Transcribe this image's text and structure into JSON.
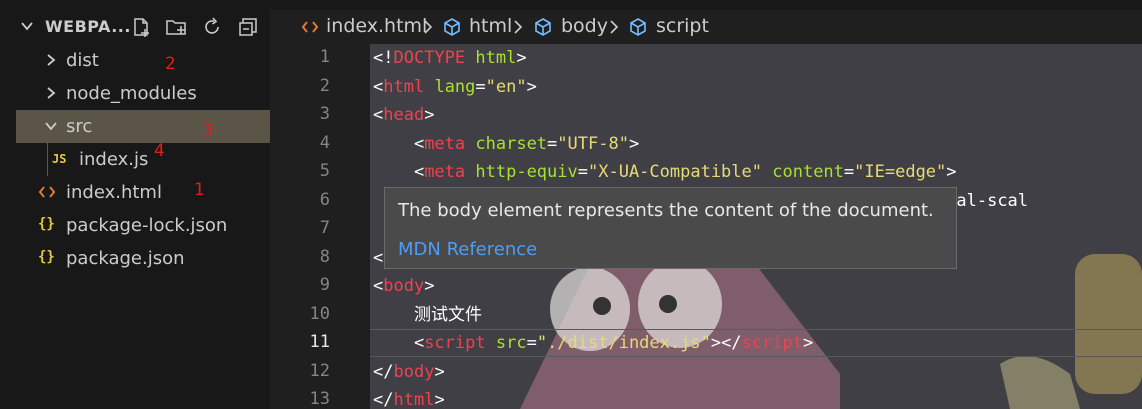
{
  "sidebar": {
    "title": "WEBPA...",
    "actions": [
      "new-file-icon",
      "new-folder-icon",
      "refresh-icon",
      "collapse-all-icon"
    ],
    "items": [
      {
        "label": "dist",
        "kind": "folder",
        "expanded": false,
        "annotation": "2"
      },
      {
        "label": "node_modules",
        "kind": "folder",
        "expanded": false,
        "annotation": ""
      },
      {
        "label": "src",
        "kind": "folder",
        "expanded": true,
        "selected": true,
        "annotation": "3"
      },
      {
        "label": "index.js",
        "kind": "js",
        "icon_text": "JS",
        "annotation": "4"
      },
      {
        "label": "index.html",
        "kind": "html",
        "annotation": "1"
      },
      {
        "label": "package-lock.json",
        "kind": "json",
        "icon_text": "{}",
        "annotation": ""
      },
      {
        "label": "package.json",
        "kind": "json",
        "icon_text": "{}",
        "annotation": ""
      }
    ]
  },
  "breadcrumb": [
    "index.html",
    "html",
    "body",
    "script"
  ],
  "editor": {
    "line_numbers": [
      "1",
      "2",
      "3",
      "4",
      "5",
      "6",
      "7",
      "8",
      "9",
      "10",
      "11",
      "12",
      "13"
    ],
    "active_line": "11",
    "lines": [
      [
        [
          "br",
          "<!"
        ],
        [
          "tag",
          "DOCTYPE"
        ],
        [
          "br",
          " "
        ],
        [
          "attr",
          "html"
        ],
        [
          "br",
          ">"
        ]
      ],
      [
        [
          "br",
          "<"
        ],
        [
          "tag",
          "html"
        ],
        [
          "br",
          " "
        ],
        [
          "attr",
          "lang"
        ],
        [
          "br",
          "="
        ],
        [
          "str",
          "\"en\""
        ],
        [
          "br",
          ">"
        ]
      ],
      [
        [
          "br",
          "<"
        ],
        [
          "tag",
          "head"
        ],
        [
          "br",
          ">"
        ]
      ],
      [
        [
          "br",
          "    <"
        ],
        [
          "tag",
          "meta"
        ],
        [
          "br",
          " "
        ],
        [
          "attr",
          "charset"
        ],
        [
          "br",
          "="
        ],
        [
          "str",
          "\"UTF-8\""
        ],
        [
          "br",
          ">"
        ]
      ],
      [
        [
          "br",
          "    <"
        ],
        [
          "tag",
          "meta"
        ],
        [
          "br",
          " "
        ],
        [
          "attr",
          "http-equiv"
        ],
        [
          "br",
          "="
        ],
        [
          "str",
          "\"X-UA-Compatible\""
        ],
        [
          "br",
          " "
        ],
        [
          "attr",
          "content"
        ],
        [
          "br",
          "="
        ],
        [
          "str",
          "\"IE=edge\""
        ],
        [
          "br",
          ">"
        ]
      ],
      [
        [
          "br",
          "                                                th, initial-scal"
        ]
      ],
      [
        [
          "br",
          ""
        ]
      ],
      [
        [
          "br",
          "<"
        ]
      ],
      [
        [
          "br",
          "<"
        ],
        [
          "tag",
          "body"
        ],
        [
          "br",
          ">"
        ]
      ],
      [
        [
          "txt",
          "    测试文件"
        ]
      ],
      [
        [
          "br",
          "    <"
        ],
        [
          "tag",
          "script"
        ],
        [
          "br",
          " "
        ],
        [
          "attr",
          "src"
        ],
        [
          "br",
          "="
        ],
        [
          "str",
          "\"./dist/index.js\""
        ],
        [
          "br",
          "></"
        ],
        [
          "tag",
          "script"
        ],
        [
          "br",
          ">"
        ]
      ],
      [
        [
          "br",
          "</"
        ],
        [
          "tag",
          "body"
        ],
        [
          "br",
          ">"
        ]
      ],
      [
        [
          "br",
          "</"
        ],
        [
          "tag",
          "html"
        ],
        [
          "br",
          ">"
        ]
      ]
    ]
  },
  "hover": {
    "description": "The body element represents the content of the document.",
    "link": "MDN Reference"
  },
  "colors": {
    "tag": "#f0424c",
    "attribute": "#a6e22e",
    "string": "#e6db74",
    "link": "#4d9df8",
    "annotation": "#e81b1b",
    "selected_row": "#5a5546"
  }
}
